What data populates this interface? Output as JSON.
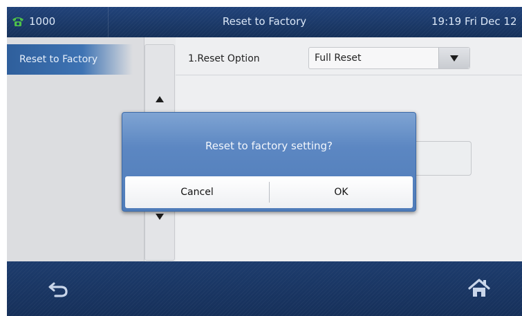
{
  "status_bar": {
    "line_number": "1000",
    "title": "Reset to Factory",
    "clock": "19:19 Fri Dec 12"
  },
  "sidebar": {
    "items": [
      {
        "label": "Reset to Factory",
        "selected": true
      }
    ]
  },
  "settings": {
    "rows": [
      {
        "label": "1.Reset Option",
        "value": "Full Reset"
      }
    ]
  },
  "dialog": {
    "message": "Reset to factory setting?",
    "cancel_label": "Cancel",
    "ok_label": "OK"
  },
  "bottom_bar": {
    "left_icon": "back-icon",
    "right_icon": "home-icon"
  },
  "colors": {
    "accent": "#3e73b3",
    "dialog_blue": "#5c87c2",
    "bar_dark": "#17335d",
    "line_icon_green": "#4fc14a"
  }
}
